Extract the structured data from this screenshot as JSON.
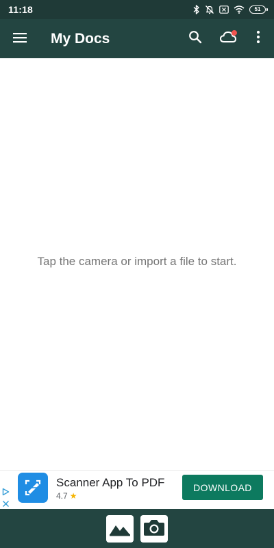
{
  "status_bar": {
    "time": "11:18",
    "battery": "51",
    "icons": [
      "bluetooth-icon",
      "mute-icon",
      "sim-x-icon",
      "wifi-icon",
      "battery-icon"
    ]
  },
  "app_bar": {
    "title": "My Docs",
    "icons": [
      "menu-icon",
      "search-icon",
      "cloud-icon",
      "more-vert-icon"
    ],
    "cloud_badge_color": "#f0544f"
  },
  "main": {
    "empty_message": "Tap the camera or import a file to start."
  },
  "ad": {
    "title": "Scanner App To PDF",
    "rating": "4.7",
    "button_label": "DOWNLOAD",
    "icons": [
      "ad-choices-icon",
      "ad-close-icon",
      "scanner-app-icon",
      "star-icon"
    ]
  },
  "bottom_bar": {
    "icons": [
      "gallery-icon",
      "camera-icon"
    ]
  },
  "colors": {
    "status_bar": "#1f3a37",
    "app_bar": "#234541",
    "download_button": "#0d7a5f",
    "ad_icon": "#1f8de4",
    "text_muted": "#757575"
  }
}
